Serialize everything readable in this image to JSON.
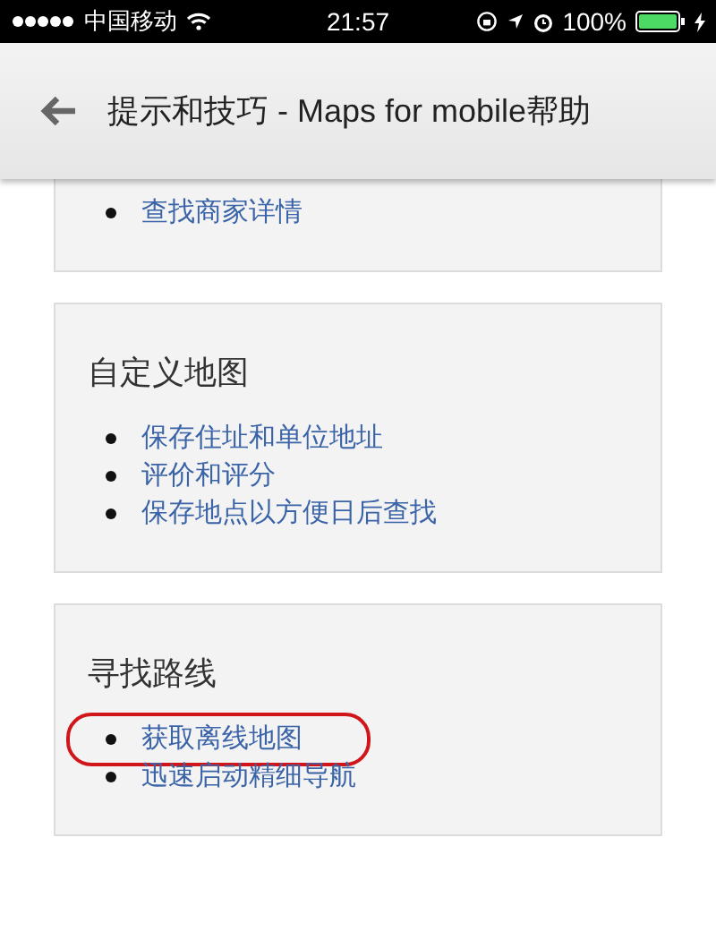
{
  "status_bar": {
    "carrier": "中国移动",
    "time": "21:57",
    "battery": "100%"
  },
  "header": {
    "title": "提示和技巧 - Maps for mobile帮助"
  },
  "sections": [
    {
      "items": [
        {
          "label": "查找商家详情",
          "circled": false
        }
      ]
    },
    {
      "title": "自定义地图",
      "items": [
        {
          "label": "保存住址和单位地址",
          "circled": false
        },
        {
          "label": "评价和评分",
          "circled": false
        },
        {
          "label": "保存地点以方便日后查找",
          "circled": false
        }
      ]
    },
    {
      "title": "寻找路线",
      "items": [
        {
          "label": "获取离线地图",
          "circled": true
        },
        {
          "label": "迅速启动精细导航",
          "circled": false
        }
      ]
    }
  ]
}
